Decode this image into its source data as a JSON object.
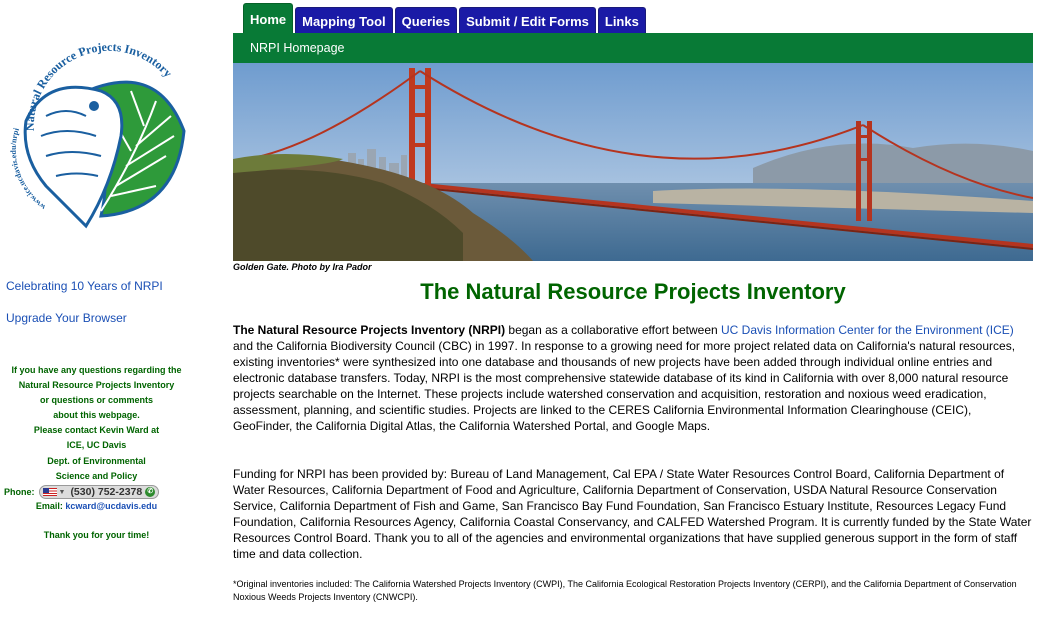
{
  "tabs": [
    {
      "label": "Home",
      "active": true
    },
    {
      "label": "Mapping Tool",
      "active": false
    },
    {
      "label": "Queries",
      "active": false
    },
    {
      "label": "Submit / Edit Forms",
      "active": false
    },
    {
      "label": "Links",
      "active": false
    }
  ],
  "subnav": {
    "label": "NRPI Homepage"
  },
  "logo": {
    "arc_text": "Natural Resource Projects Inventory",
    "url_text": "www.ice.ucdavis.edu/nrpi"
  },
  "sidebar": {
    "links": [
      "Celebrating 10 Years of NRPI",
      "Upgrade Your Browser"
    ],
    "contact_lines": [
      "If you have any questions regarding the",
      "Natural Resource Projects Inventory",
      "or questions or comments",
      "about this webpage.",
      "Please contact Kevin Ward at",
      "ICE, UC Davis",
      "Dept. of Environmental",
      "Science and Policy"
    ],
    "phone_label": "Phone:",
    "phone_number": "(530) 752-2378",
    "email_label": "Email:",
    "email": "kcward@ucdavis.edu",
    "thanks": "Thank you for your time!"
  },
  "hero": {
    "caption": "Golden Gate. Photo by Ira Pador"
  },
  "main": {
    "title": "The Natural Resource Projects Inventory",
    "intro_bold": "The Natural Resource Projects Inventory (NRPI)",
    "intro_before_link": " began as a collaborative effort between ",
    "intro_link": "UC Davis Information Center for the Environment (ICE)",
    "intro_after_link": " and the California Biodiversity Council (CBC) in 1997. In response to a growing need for more project related data on California's natural resources, existing inventories* were synthesized into one database and thousands of new projects have been added through individual online entries and electronic database transfers. Today, NRPI is the most comprehensive statewide database of its kind in California with over 8,000 natural resource projects searchable on the Internet. These projects include watershed conservation and acquisition, restoration and noxious weed eradication, assessment, planning, and scientific studies. Projects are linked to the CERES California Environmental Information Clearinghouse (CEIC), GeoFinder, the California Digital Atlas, the California Watershed Portal, and Google Maps.",
    "funding": "Funding for NRPI has been provided by: Bureau of Land Management, Cal EPA / State Water Resources Control Board, California Department of Water Resources, California Department of Food and Agriculture, California Department of Conservation, USDA Natural Resource Conservation Service, California Department of Fish and Game, San Francisco Bay Fund Foundation, San Francisco Estuary Institute, Resources Legacy Fund Foundation, California Resources Agency, California Coastal Conservancy, and CALFED Watershed Program. It is currently funded by the State Water Resources Control Board. Thank you to all of the agencies and environmental organizations that have supplied generous support in the form of staff time and data collection.",
    "footnote": "*Original inventories included: The California Watershed Projects Inventory (CWPI), The California Ecological Restoration Projects Inventory (CERPI), and the California Department of Conservation Noxious Weeds Projects Inventory (CNWCPI)."
  },
  "colors": {
    "green": "#087a36",
    "tab_blue": "#1a1aa6",
    "link": "#1a4fb5",
    "title_green": "#006400"
  }
}
